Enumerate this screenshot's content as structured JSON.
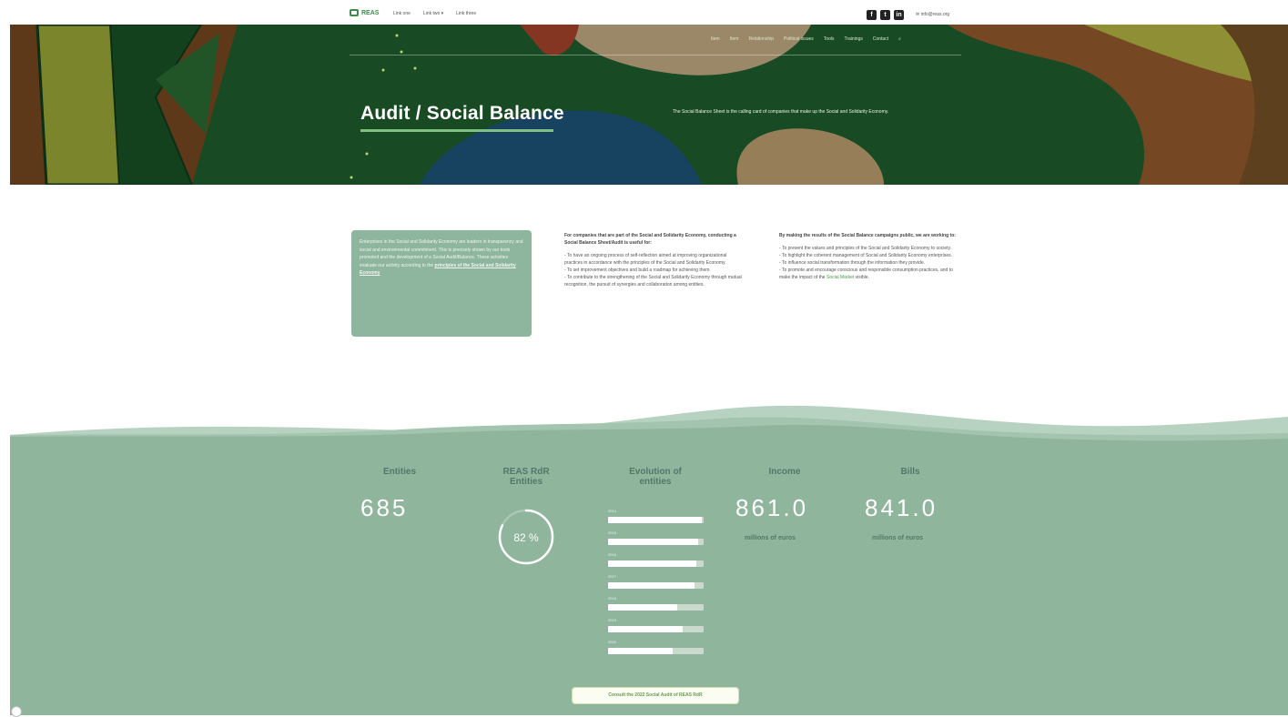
{
  "topbar": {
    "logo_text": "REAS",
    "links": [
      "Link one",
      "Link two ▾",
      "Link three"
    ],
    "socials": [
      "f",
      "t",
      "in"
    ],
    "email": "info@reas.org"
  },
  "hero": {
    "nav": [
      "Item",
      "Item",
      "Relationship",
      "Political issues",
      "Tools",
      "Trainings",
      "Contact",
      "Search"
    ],
    "title": "Audit / Social Balance",
    "description": "The Social Balance Sheet is the calling card of companies that make up the Social and Solidarity Economy."
  },
  "info": {
    "box_text": "Enterprises in the Social and Solidarity Economy are leaders in transparency and social and environmental commitment. This is precisely shown by our tools promoted and the development of a Social Audit/Balance. These activities evaluate our activity according to the ",
    "box_link": "principles of the Social and Solidarity Economy",
    "col1_head": "For companies that are part of the Social and Solidarity Economy, conducting a Social Balance Sheet/Audit is useful for:",
    "col1_items": [
      "- To have an ongoing process of self-reflection aimed at improving organizational practices in accordance with the principles of the Social and Solidarity Economy.",
      "- To set improvement objectives and build a roadmap for achieving them.",
      "- To contribute to the strengthening of the Social and Solidarity Economy through mutual recognition, the pursuit of synergies and collaboration among entities."
    ],
    "col2_head": "By making the results of the Social Balance campaigns public, we are working to:",
    "col2_items": [
      "- To present the values and principles of the Social and Solidarity Economy to society.",
      "- To highlight the coherent management of Social and Solidarity Economy enterprises.",
      "- To influence social transformation through the information they provide.",
      "- To promote and encourage conscious and responsible consumption practices, and to make the impact of the"
    ],
    "col2_link": "Social Market",
    "col2_tail": " visible."
  },
  "stats": {
    "entities_label": "Entities",
    "entities_value": "685",
    "reas_label": "REAS RdR Entities",
    "reas_percent": 82,
    "reas_value_text": "82 %",
    "evolution_label": "Evolution of entities",
    "evolution": [
      {
        "year": "2014",
        "fill": 0.98
      },
      {
        "year": "2015",
        "fill": 0.94
      },
      {
        "year": "2016",
        "fill": 0.92
      },
      {
        "year": "2017",
        "fill": 0.9
      },
      {
        "year": "2018",
        "fill": 0.72
      },
      {
        "year": "2019",
        "fill": 0.78
      },
      {
        "year": "2020",
        "fill": 0.68
      }
    ],
    "income_label": "Income",
    "income_value": "861.0",
    "income_unit": "millions of euros",
    "bills_label": "Bills",
    "bills_value": "841.0",
    "bills_unit": "millions of euros",
    "cta": "Consult the 2022 Social Audit of REAS RdR"
  },
  "colors": {
    "band": "#8fb59d",
    "band_light": "#a8c8b3",
    "hero_green": "#1d5226"
  }
}
